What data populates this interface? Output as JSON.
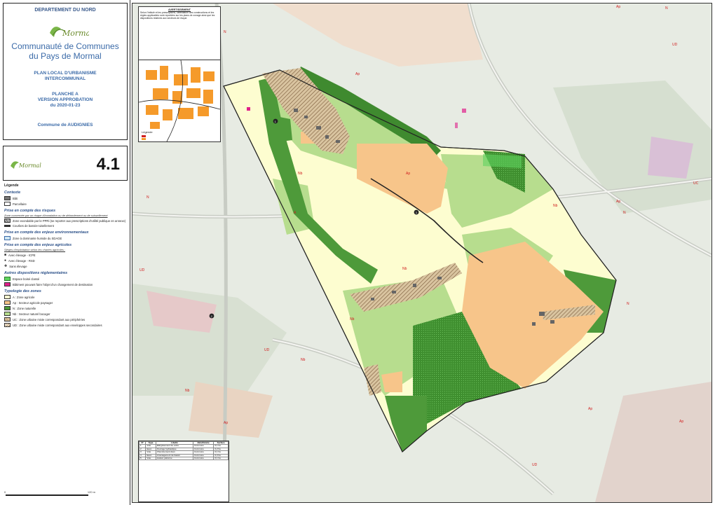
{
  "sidebar": {
    "department": "DEPARTEMENT DU NORD",
    "logo_text": "Mormal",
    "intercommunality_line1": "Communauté de Communes",
    "intercommunality_line2": "du Pays de Mormal",
    "plan_line1": "PLAN LOCAL D'URBANISME",
    "plan_line2": "INTERCOMMUNAL",
    "planche_line1": "PLANCHE A",
    "planche_line2": "VERSION APPROBATION",
    "planche_line3": "du 2020-01-23",
    "commune": "Commune de AUDIGNIES",
    "sheet_number": "4.1"
  },
  "legend": {
    "title": "Légende",
    "context_title": "Contexte",
    "context_items": [
      "Bâti",
      "Parcellaire"
    ],
    "risks_title": "Prise en compte des risques",
    "risks_sub": "Zone concernée par un risque d'inondation ou de débordement ou de ruissellement",
    "risks_items": [
      "Zone exondable par le PPRi (se reporter aux prescriptions d'utilité publique en annexe)",
      "Courbes de bassin-ruisellement"
    ],
    "env_title": "Prise en compte des enjeux environnementaux",
    "env_items": [
      "Zone à dominante humide du SDAGE"
    ],
    "agri_title": "Prise en compte des enjeux agricoles",
    "agri_sub": "Sièges d'exploitation selon les chartes agricoles :",
    "agri_items": [
      "Avec élevage - ICPE",
      "Avec élevage - RSD",
      "Sans élevage"
    ],
    "reg_title": "Autres dispositions réglementaires",
    "reg_items": [
      "Espace boisé classé",
      "Bâtiment pouvant faire l'objet d'un changement de destination"
    ],
    "zones_title": "Typologie des zones",
    "zones": [
      {
        "label": "A : Zone agricole",
        "color": "#fdfdd0"
      },
      {
        "label": "Ap : Secteur agricole paysager",
        "color": "#f7c58a"
      },
      {
        "label": "N : Zone naturelle",
        "color": "#4e9a3a"
      },
      {
        "label": "Nb : Secteur naturel bocager",
        "color": "#b7dd8e"
      },
      {
        "label": "UC : Zone urbaine mixte correspondant aux périphéries",
        "color": "#e6c8a0"
      },
      {
        "label": "UD : Zone urbaine mixte correspondant aux enveloppes secondaires",
        "color": "#f2e3c8"
      }
    ]
  },
  "scale": {
    "left": "0",
    "right": "120 m"
  },
  "inset": {
    "title": "AVERTISSEMENT",
    "body": "Selon l'intitulé et les prescriptions, l'affectation des constructions et les règles applicables sont reportées sur les plans de zonage ainsi que les dispositions relatives aux secteurs de risque.",
    "map_legend_title": "Légende"
  },
  "map_labels": [
    "Ap",
    "Ap",
    "N",
    "UD",
    "N",
    "Nb",
    "Nb",
    "Ap",
    "UC",
    "UD",
    "N",
    "Nb",
    "Ap",
    "Nb",
    "UD",
    "Ap",
    "Nb",
    "N",
    "A",
    "Ap",
    "Nb",
    "UD",
    "Ap",
    "N"
  ],
  "map_markers": [
    "1",
    "2",
    "3"
  ],
  "table": {
    "headers": [
      "N°",
      "Type",
      "Libellé",
      "Bénéficiaire",
      "Surface"
    ],
    "rows": [
      [
        "1",
        "Voie",
        "Élargissement de voirie",
        "Commune",
        "0,1 ha"
      ],
      [
        "2",
        "Eaux",
        "Ouvrage hydraulique",
        "Commune",
        "0,2 ha"
      ],
      [
        "3",
        "Voie",
        "Cheminement doux",
        "Commune",
        "0,1 ha"
      ],
      [
        "4",
        "Eaux",
        "Aménagement de bassin",
        "Commune",
        "0,3 ha"
      ],
      [
        "5",
        "Voie",
        "Liaison piétonne",
        "Commune",
        "0,1 ha"
      ]
    ]
  },
  "colors": {
    "A": "#fdfdd0",
    "Ap": "#f7c58a",
    "N": "#4e9a3a",
    "Nb": "#b7dd8e",
    "UC": "#e6c8a0",
    "base": "#e7ebe3",
    "commune_border": "#222222",
    "label_red": "#d12020"
  }
}
